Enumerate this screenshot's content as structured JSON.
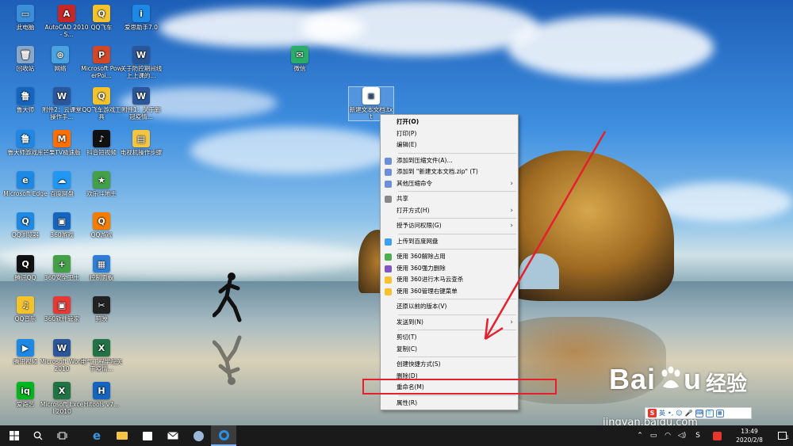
{
  "desktop_icons": [
    {
      "label": "此电脑",
      "color": "#3b8fd9",
      "glyph": "▭"
    },
    {
      "label": "AutoCAD 2010 - S...",
      "color": "#c62828",
      "glyph": "A"
    },
    {
      "label": "QQ飞车",
      "color": "#f4c22b",
      "glyph": "Q"
    },
    {
      "label": "爱思助手7.0",
      "color": "#1e88e5",
      "glyph": "i"
    },
    {
      "label": "回收站",
      "color": "#8aa8c8",
      "glyph": "🗑"
    },
    {
      "label": "网络",
      "color": "#4aa3df",
      "glyph": "⊕"
    },
    {
      "label": "Microsoft PowerPoi...",
      "color": "#d24726",
      "glyph": "P"
    },
    {
      "label": "关于防控期间线上上课的...",
      "color": "#2b579a",
      "glyph": "W"
    },
    {
      "label": "微信",
      "color": "#2aae67",
      "glyph": "✉"
    },
    {
      "label": "鲁大师",
      "color": "#1565c0",
      "glyph": "鲁"
    },
    {
      "label": "附件2：云课堂操作手...",
      "color": "#2b579a",
      "glyph": "W"
    },
    {
      "label": "QQ飞车游戏工具",
      "color": "#f4c22b",
      "glyph": "Q"
    },
    {
      "label": "附件1：关于新冠疫情...",
      "color": "#2b579a",
      "glyph": "W"
    },
    {
      "label": "新建文本文档.txt",
      "color": "#ffffff",
      "glyph": "≡"
    },
    {
      "label": "鲁大师游戏库",
      "color": "#1e88e5",
      "glyph": "鲁"
    },
    {
      "label": "芒果TV极速版",
      "color": "#ff6f00",
      "glyph": "M"
    },
    {
      "label": "抖音短视频",
      "color": "#111111",
      "glyph": "♪"
    },
    {
      "label": "电视机操作步骤",
      "color": "#f4c542",
      "glyph": "▤"
    },
    {
      "label": "Microsoft Edge",
      "color": "#1e88e5",
      "glyph": "e"
    },
    {
      "label": "百度网盘",
      "color": "#2196f3",
      "glyph": "☁"
    },
    {
      "label": "欢乐斗地主",
      "color": "#43a047",
      "glyph": "★"
    },
    {
      "label": "QQ浏览器",
      "color": "#1e88e5",
      "glyph": "Q"
    },
    {
      "label": "360游戏",
      "color": "#1565c0",
      "glyph": "▣"
    },
    {
      "label": "QQ游戏",
      "color": "#f57c00",
      "glyph": "Q"
    },
    {
      "label": "腾讯QQ",
      "color": "#111111",
      "glyph": "Q"
    },
    {
      "label": "360安全卫士",
      "color": "#43a047",
      "glyph": "+"
    },
    {
      "label": "控制面板",
      "color": "#2e7dd7",
      "glyph": "▦"
    },
    {
      "label": "QQ音乐",
      "color": "#f4c22b",
      "glyph": "♫"
    },
    {
      "label": "360软件管家",
      "color": "#e53935",
      "glyph": "▣"
    },
    {
      "label": "剪映",
      "color": "#222222",
      "glyph": "✂"
    },
    {
      "label": "腾讯视频",
      "color": "#1e88e5",
      "glyph": "▶"
    },
    {
      "label": "Microsoft Word 2010",
      "color": "#2b579a",
      "glyph": "W"
    },
    {
      "label": "电气工程学院关于疫情...",
      "color": "#217346",
      "glyph": "X"
    },
    {
      "label": "爱奇艺",
      "color": "#00b51d",
      "glyph": "iq"
    },
    {
      "label": "Microsoft Excel 2010",
      "color": "#217346",
      "glyph": "X"
    },
    {
      "label": "Hitools v7...",
      "color": "#1565c0",
      "glyph": "H"
    }
  ],
  "context_menu": {
    "items": [
      {
        "type": "item",
        "label": "打开(O)",
        "bold": true
      },
      {
        "type": "item",
        "label": "打印(P)"
      },
      {
        "type": "item",
        "label": "编辑(E)"
      },
      {
        "type": "sep"
      },
      {
        "type": "item",
        "label": "添加到压缩文件(A)...",
        "icon": "#6d8fd8"
      },
      {
        "type": "item",
        "label": "添加到 \"新建文本文档.zip\" (T)",
        "icon": "#6d8fd8"
      },
      {
        "type": "item",
        "label": "其他压缩命令",
        "icon": "#6d8fd8",
        "submenu": true
      },
      {
        "type": "sep"
      },
      {
        "type": "item",
        "label": "共享",
        "icon": "#888888"
      },
      {
        "type": "item",
        "label": "打开方式(H)",
        "submenu": true
      },
      {
        "type": "sep"
      },
      {
        "type": "item",
        "label": "授予访问权限(G)",
        "submenu": true
      },
      {
        "type": "sep"
      },
      {
        "type": "item",
        "label": "上传到百度网盘",
        "icon": "#3ba1f5"
      },
      {
        "type": "sep"
      },
      {
        "type": "item",
        "label": "使用 360解除占用",
        "icon": "#4caf50"
      },
      {
        "type": "item",
        "label": "使用 360强力删除",
        "icon": "#7e57c2"
      },
      {
        "type": "item",
        "label": "使用 360进行木马云查杀",
        "icon": "#fbc02d"
      },
      {
        "type": "item",
        "label": "使用 360管理右键菜单",
        "icon": "#fbc02d"
      },
      {
        "type": "sep"
      },
      {
        "type": "item",
        "label": "还原以前的版本(V)"
      },
      {
        "type": "sep"
      },
      {
        "type": "item",
        "label": "发送到(N)",
        "submenu": true
      },
      {
        "type": "sep"
      },
      {
        "type": "item",
        "label": "剪切(T)"
      },
      {
        "type": "item",
        "label": "复制(C)"
      },
      {
        "type": "sep"
      },
      {
        "type": "item",
        "label": "创建快捷方式(S)"
      },
      {
        "type": "item",
        "label": "删除(D)"
      },
      {
        "type": "item",
        "label": "重命名(M)"
      },
      {
        "type": "sep"
      },
      {
        "type": "item",
        "label": "属性(R)"
      }
    ]
  },
  "watermark": {
    "brand": "Bai",
    "brand_tail": "u",
    "suffix": "经验",
    "url": "jingyan.baidu.com"
  },
  "ime_bar": {
    "s_logo": "S",
    "mode": "英"
  },
  "taskbar": {
    "time": "13:49",
    "date": "2020/2/8",
    "lang_indicator": "S",
    "notification_count": "1"
  },
  "colors": {
    "annotation_red": "#e5202c",
    "taskbar_bg": "#1a1a1a",
    "menu_bg": "#f2f2f2"
  }
}
